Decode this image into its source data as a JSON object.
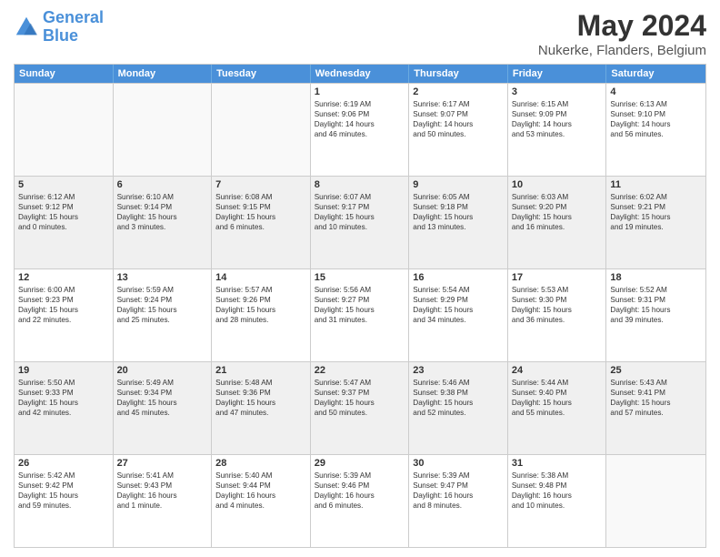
{
  "header": {
    "logo_general": "General",
    "logo_blue": "Blue",
    "main_title": "May 2024",
    "subtitle": "Nukerke, Flanders, Belgium"
  },
  "weekdays": [
    "Sunday",
    "Monday",
    "Tuesday",
    "Wednesday",
    "Thursday",
    "Friday",
    "Saturday"
  ],
  "rows": [
    [
      {
        "day": "",
        "lines": [],
        "empty": true
      },
      {
        "day": "",
        "lines": [],
        "empty": true
      },
      {
        "day": "",
        "lines": [],
        "empty": true
      },
      {
        "day": "1",
        "lines": [
          "Sunrise: 6:19 AM",
          "Sunset: 9:06 PM",
          "Daylight: 14 hours",
          "and 46 minutes."
        ],
        "empty": false
      },
      {
        "day": "2",
        "lines": [
          "Sunrise: 6:17 AM",
          "Sunset: 9:07 PM",
          "Daylight: 14 hours",
          "and 50 minutes."
        ],
        "empty": false
      },
      {
        "day": "3",
        "lines": [
          "Sunrise: 6:15 AM",
          "Sunset: 9:09 PM",
          "Daylight: 14 hours",
          "and 53 minutes."
        ],
        "empty": false
      },
      {
        "day": "4",
        "lines": [
          "Sunrise: 6:13 AM",
          "Sunset: 9:10 PM",
          "Daylight: 14 hours",
          "and 56 minutes."
        ],
        "empty": false
      }
    ],
    [
      {
        "day": "5",
        "lines": [
          "Sunrise: 6:12 AM",
          "Sunset: 9:12 PM",
          "Daylight: 15 hours",
          "and 0 minutes."
        ],
        "empty": false
      },
      {
        "day": "6",
        "lines": [
          "Sunrise: 6:10 AM",
          "Sunset: 9:14 PM",
          "Daylight: 15 hours",
          "and 3 minutes."
        ],
        "empty": false
      },
      {
        "day": "7",
        "lines": [
          "Sunrise: 6:08 AM",
          "Sunset: 9:15 PM",
          "Daylight: 15 hours",
          "and 6 minutes."
        ],
        "empty": false
      },
      {
        "day": "8",
        "lines": [
          "Sunrise: 6:07 AM",
          "Sunset: 9:17 PM",
          "Daylight: 15 hours",
          "and 10 minutes."
        ],
        "empty": false
      },
      {
        "day": "9",
        "lines": [
          "Sunrise: 6:05 AM",
          "Sunset: 9:18 PM",
          "Daylight: 15 hours",
          "and 13 minutes."
        ],
        "empty": false
      },
      {
        "day": "10",
        "lines": [
          "Sunrise: 6:03 AM",
          "Sunset: 9:20 PM",
          "Daylight: 15 hours",
          "and 16 minutes."
        ],
        "empty": false
      },
      {
        "day": "11",
        "lines": [
          "Sunrise: 6:02 AM",
          "Sunset: 9:21 PM",
          "Daylight: 15 hours",
          "and 19 minutes."
        ],
        "empty": false
      }
    ],
    [
      {
        "day": "12",
        "lines": [
          "Sunrise: 6:00 AM",
          "Sunset: 9:23 PM",
          "Daylight: 15 hours",
          "and 22 minutes."
        ],
        "empty": false
      },
      {
        "day": "13",
        "lines": [
          "Sunrise: 5:59 AM",
          "Sunset: 9:24 PM",
          "Daylight: 15 hours",
          "and 25 minutes."
        ],
        "empty": false
      },
      {
        "day": "14",
        "lines": [
          "Sunrise: 5:57 AM",
          "Sunset: 9:26 PM",
          "Daylight: 15 hours",
          "and 28 minutes."
        ],
        "empty": false
      },
      {
        "day": "15",
        "lines": [
          "Sunrise: 5:56 AM",
          "Sunset: 9:27 PM",
          "Daylight: 15 hours",
          "and 31 minutes."
        ],
        "empty": false
      },
      {
        "day": "16",
        "lines": [
          "Sunrise: 5:54 AM",
          "Sunset: 9:29 PM",
          "Daylight: 15 hours",
          "and 34 minutes."
        ],
        "empty": false
      },
      {
        "day": "17",
        "lines": [
          "Sunrise: 5:53 AM",
          "Sunset: 9:30 PM",
          "Daylight: 15 hours",
          "and 36 minutes."
        ],
        "empty": false
      },
      {
        "day": "18",
        "lines": [
          "Sunrise: 5:52 AM",
          "Sunset: 9:31 PM",
          "Daylight: 15 hours",
          "and 39 minutes."
        ],
        "empty": false
      }
    ],
    [
      {
        "day": "19",
        "lines": [
          "Sunrise: 5:50 AM",
          "Sunset: 9:33 PM",
          "Daylight: 15 hours",
          "and 42 minutes."
        ],
        "empty": false
      },
      {
        "day": "20",
        "lines": [
          "Sunrise: 5:49 AM",
          "Sunset: 9:34 PM",
          "Daylight: 15 hours",
          "and 45 minutes."
        ],
        "empty": false
      },
      {
        "day": "21",
        "lines": [
          "Sunrise: 5:48 AM",
          "Sunset: 9:36 PM",
          "Daylight: 15 hours",
          "and 47 minutes."
        ],
        "empty": false
      },
      {
        "day": "22",
        "lines": [
          "Sunrise: 5:47 AM",
          "Sunset: 9:37 PM",
          "Daylight: 15 hours",
          "and 50 minutes."
        ],
        "empty": false
      },
      {
        "day": "23",
        "lines": [
          "Sunrise: 5:46 AM",
          "Sunset: 9:38 PM",
          "Daylight: 15 hours",
          "and 52 minutes."
        ],
        "empty": false
      },
      {
        "day": "24",
        "lines": [
          "Sunrise: 5:44 AM",
          "Sunset: 9:40 PM",
          "Daylight: 15 hours",
          "and 55 minutes."
        ],
        "empty": false
      },
      {
        "day": "25",
        "lines": [
          "Sunrise: 5:43 AM",
          "Sunset: 9:41 PM",
          "Daylight: 15 hours",
          "and 57 minutes."
        ],
        "empty": false
      }
    ],
    [
      {
        "day": "26",
        "lines": [
          "Sunrise: 5:42 AM",
          "Sunset: 9:42 PM",
          "Daylight: 15 hours",
          "and 59 minutes."
        ],
        "empty": false
      },
      {
        "day": "27",
        "lines": [
          "Sunrise: 5:41 AM",
          "Sunset: 9:43 PM",
          "Daylight: 16 hours",
          "and 1 minute."
        ],
        "empty": false
      },
      {
        "day": "28",
        "lines": [
          "Sunrise: 5:40 AM",
          "Sunset: 9:44 PM",
          "Daylight: 16 hours",
          "and 4 minutes."
        ],
        "empty": false
      },
      {
        "day": "29",
        "lines": [
          "Sunrise: 5:39 AM",
          "Sunset: 9:46 PM",
          "Daylight: 16 hours",
          "and 6 minutes."
        ],
        "empty": false
      },
      {
        "day": "30",
        "lines": [
          "Sunrise: 5:39 AM",
          "Sunset: 9:47 PM",
          "Daylight: 16 hours",
          "and 8 minutes."
        ],
        "empty": false
      },
      {
        "day": "31",
        "lines": [
          "Sunrise: 5:38 AM",
          "Sunset: 9:48 PM",
          "Daylight: 16 hours",
          "and 10 minutes."
        ],
        "empty": false
      },
      {
        "day": "",
        "lines": [],
        "empty": true
      }
    ]
  ]
}
